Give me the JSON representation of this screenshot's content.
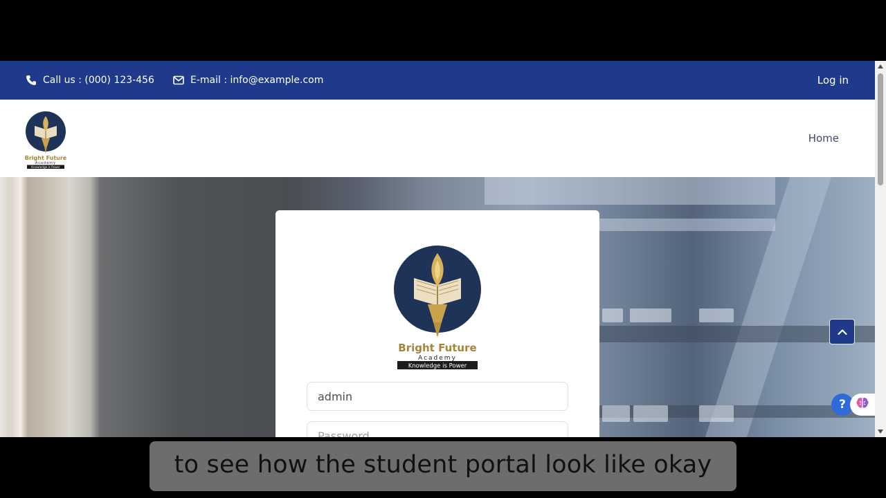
{
  "topbar": {
    "phone_icon": "phone-icon",
    "call_text": "Call us : (000) 123-456",
    "mail_icon": "envelope-icon",
    "email_text": "E-mail : info@example.com",
    "login_label": "Log in",
    "background": "#1f3a8a"
  },
  "navbar": {
    "logo": {
      "name": "Bright Future",
      "sub": "Academy",
      "tagline": "Knowledge is Power"
    },
    "home_label": "Home"
  },
  "login_card": {
    "logo": {
      "name": "Bright Future",
      "sub": "Academy",
      "tagline": "Knowledge is Power"
    },
    "username_value": "admin",
    "password_placeholder": "Password"
  },
  "widgets": {
    "back_to_top_icon": "chevron-up-icon",
    "help_label": "?",
    "help_icon": "brain-icon"
  },
  "caption": {
    "text": "to see how the student portal look like okay"
  },
  "colors": {
    "brand_blue": "#1f3a8a",
    "logo_navy": "#1e3357",
    "logo_gold": "#c9a24a"
  }
}
